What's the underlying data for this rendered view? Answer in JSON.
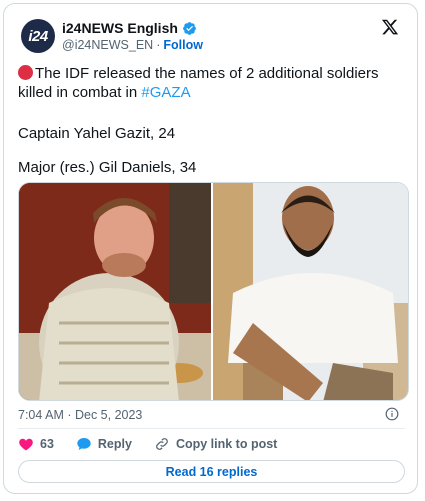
{
  "header": {
    "display_name": "i24NEWS English",
    "handle": "@i24NEWS_EN",
    "separator": "·",
    "follow_label": "Follow",
    "avatar_text": "i24"
  },
  "tweet": {
    "line1_text": "The IDF released the names of 2 additional soldiers killed in combat in ",
    "hashtag": "#GAZA",
    "line2": "Captain Yahel Gazit, 24",
    "line3": "Major (res.) Gil Daniels, 34"
  },
  "meta": {
    "timestamp": "7:04 AM · Dec 5, 2023"
  },
  "actions": {
    "likes_count": "63",
    "reply_label": "Reply",
    "copy_label": "Copy link to post"
  },
  "footer": {
    "read_replies_label": "Read 16 replies"
  },
  "colors": {
    "link": "#1d9bf0",
    "follow": "#0069d1",
    "like": "#f91880",
    "verified": "#1d9bf0",
    "red_dot": "#dd2e44"
  },
  "icons": [
    "verified-badge-icon",
    "x-logo-icon",
    "info-icon",
    "heart-icon",
    "reply-icon",
    "link-icon"
  ]
}
